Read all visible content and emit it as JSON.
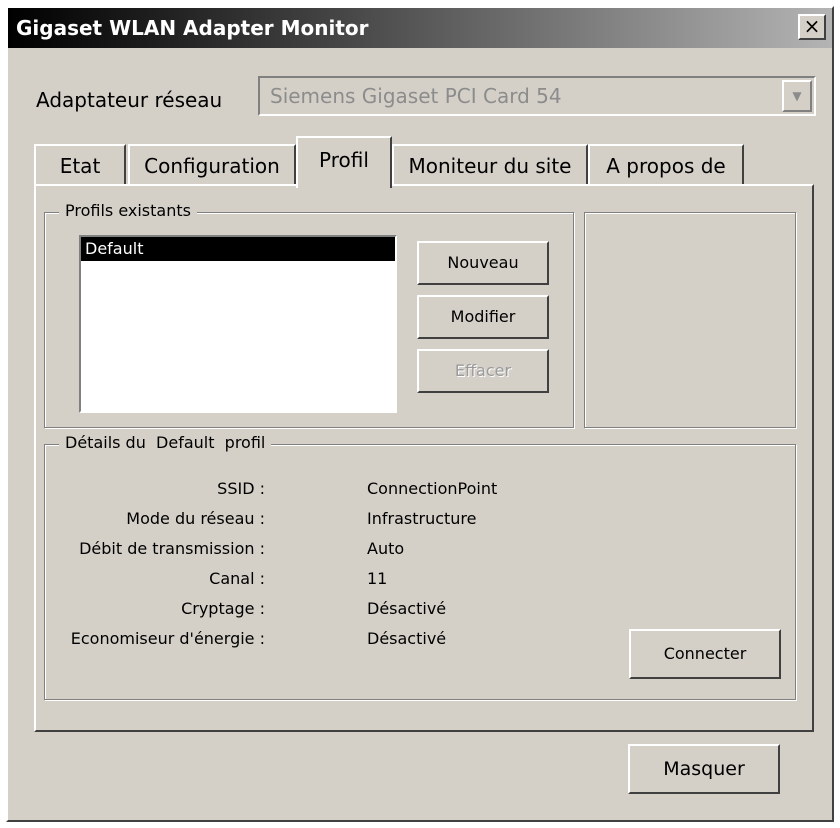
{
  "window": {
    "title": "Gigaset WLAN Adapter Monitor",
    "close_glyph": "×"
  },
  "adapter": {
    "label": "Adaptateur réseau",
    "value": "Siemens Gigaset PCI Card 54"
  },
  "tabs": [
    {
      "label": "Etat",
      "active": false
    },
    {
      "label": "Configuration",
      "active": false
    },
    {
      "label": "Profil",
      "active": true
    },
    {
      "label": "Moniteur du site",
      "active": false
    },
    {
      "label": "A propos de",
      "active": false
    }
  ],
  "profiles": {
    "group_title": "Profils existants",
    "items": [
      "Default"
    ],
    "selected": "Default",
    "buttons": {
      "new": "Nouveau",
      "edit": "Modifier",
      "delete": "Effacer"
    }
  },
  "details": {
    "group_title": "Détails du  Default  profil",
    "rows": [
      {
        "key": "SSID :",
        "value": "ConnectionPoint"
      },
      {
        "key": "Mode du réseau :",
        "value": "Infrastructure"
      },
      {
        "key": "Débit de transmission :",
        "value": "Auto"
      },
      {
        "key": "Canal :",
        "value": "11"
      },
      {
        "key": "Cryptage :",
        "value": "Désactivé"
      },
      {
        "key": "Economiseur d'énergie :",
        "value": "Désactivé"
      }
    ],
    "connect_label": "Connecter"
  },
  "footer": {
    "hide_label": "Masquer"
  },
  "icons": {
    "combo_arrow": "▼"
  }
}
